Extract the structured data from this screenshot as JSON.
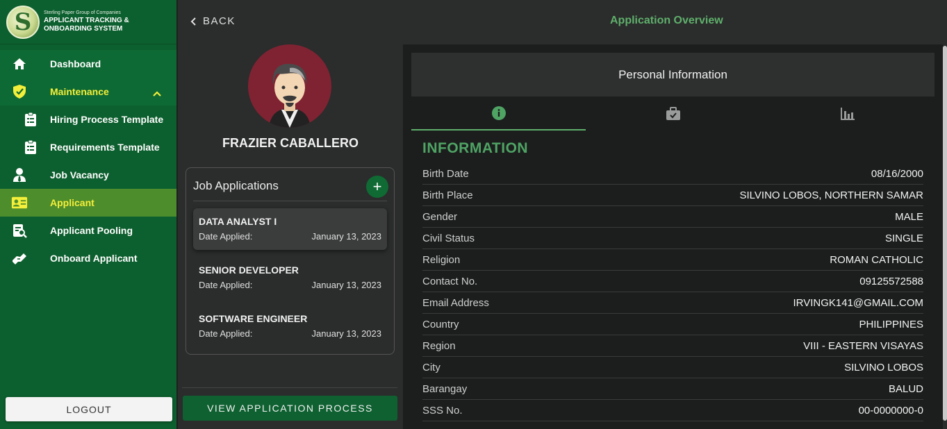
{
  "brand": {
    "logo_letter": "S",
    "subtitle": "Sterling Paper Group of Companies",
    "title_line1": "APPLICANT TRACKING &",
    "title_line2": "ONBOARDING SYSTEM"
  },
  "sidebar": {
    "items": [
      {
        "label": "Dashboard",
        "icon": "home-icon"
      },
      {
        "label": "Maintenance",
        "icon": "shield-icon"
      },
      {
        "label": "Hiring Process Template",
        "icon": "clipboard-icon"
      },
      {
        "label": "Requirements Template",
        "icon": "clipboard-icon"
      },
      {
        "label": "Job Vacancy",
        "icon": "user-tie-icon"
      },
      {
        "label": "Applicant",
        "icon": "id-card-icon"
      },
      {
        "label": "Applicant Pooling",
        "icon": "search-document-icon"
      },
      {
        "label": "Onboard Applicant",
        "icon": "handshake-icon"
      }
    ],
    "logout_label": "LOGOUT"
  },
  "header": {
    "back_label": "BACK",
    "page_title": "Application Overview"
  },
  "profile": {
    "name": "FRAZIER CABALLERO"
  },
  "job_applications": {
    "title": "Job Applications",
    "add_symbol": "+",
    "items": [
      {
        "title": "DATA ANALYST I",
        "date_label": "Date Applied:",
        "date": "January 13, 2023",
        "selected": true
      },
      {
        "title": "SENIOR DEVELOPER",
        "date_label": "Date Applied:",
        "date": "January 13, 2023",
        "selected": false
      },
      {
        "title": "SOFTWARE ENGINEER",
        "date_label": "Date Applied:",
        "date": "January 13, 2023",
        "selected": false
      }
    ]
  },
  "view_process_label": "VIEW APPLICATION PROCESS",
  "details": {
    "section_title": "Personal Information",
    "tabs": [
      {
        "icon": "info-icon",
        "active": true
      },
      {
        "icon": "briefcase-check-icon",
        "active": false
      },
      {
        "icon": "bar-chart-icon",
        "active": false
      }
    ],
    "info_heading": "INFORMATION",
    "fields": [
      {
        "label": "Birth Date",
        "value": "08/16/2000"
      },
      {
        "label": "Birth Place",
        "value": "SILVINO LOBOS, NORTHERN SAMAR"
      },
      {
        "label": "Gender",
        "value": "MALE"
      },
      {
        "label": "Civil Status",
        "value": "SINGLE"
      },
      {
        "label": "Religion",
        "value": "ROMAN CATHOLIC"
      },
      {
        "label": "Contact No.",
        "value": "09125572588"
      },
      {
        "label": "Email Address",
        "value": "IRVINGK141@GMAIL.COM"
      },
      {
        "label": "Country",
        "value": "PHILIPPINES"
      },
      {
        "label": "Region",
        "value": "VIII - EASTERN VISAYAS"
      },
      {
        "label": "City",
        "value": "SILVINO LOBOS"
      },
      {
        "label": "Barangay",
        "value": "BALUD"
      },
      {
        "label": "SSS No.",
        "value": "00-0000000-0"
      }
    ]
  },
  "colors": {
    "sidebar_bg": "#0c5f2e",
    "active_item_bg": "#4e8d2c",
    "highlight_text": "#f4ef3a",
    "accent_green": "#5fb06b",
    "avatar_bg": "#7f2332"
  }
}
